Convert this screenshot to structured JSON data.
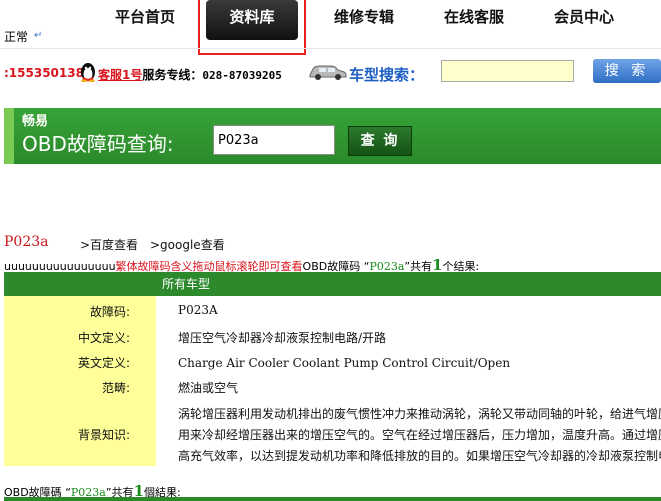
{
  "nav": {
    "items": [
      "平台首页",
      "资料库",
      "维修专辑",
      "在线客服",
      "会员中心"
    ],
    "status": "正常"
  },
  "contact": {
    "phone_partial": ":1553501388",
    "service_label": "客服1号",
    "hotline_label": "服务专线：",
    "hotline_number": "028-87039205"
  },
  "car_search": {
    "label": "车型搜索：",
    "value": "",
    "button_label": "搜 索"
  },
  "obd": {
    "brand": "畅易",
    "title": "OBD故障码查询:",
    "input_value": "P023a",
    "button_label": "查 询"
  },
  "result": {
    "code": "P023a",
    "baidu_link": ">百度查看",
    "google_link": ">google查看",
    "prefix_text": "uuuuuuuuuuuuuuuu",
    "red_note": "繁体故障码含义拖动鼠标滚轮即可查看",
    "obd_label": "OBD故障码",
    "open_quote": "“",
    "query_code": "P023a",
    "close_quote": "”共有",
    "count": "1",
    "suffix": "个结果:",
    "table_header": "所有车型",
    "rows": {
      "fault_code": {
        "label": "故障码:",
        "value": "P023A"
      },
      "cn_def": {
        "label": "中文定义:",
        "value": "增压空气冷却器冷却液泵控制电路/开路"
      },
      "en_def": {
        "label": "英文定义:",
        "value": "Charge Air Cooler Coolant Pump Control Circuit/Open"
      },
      "category": {
        "label": "范畴:",
        "value": "燃油或空气"
      },
      "background": {
        "label": "背景知识:",
        "line1": "涡轮增压器利用发动机排出的废气惯性冲力来推动涡轮，涡轮又带动同轴的叶轮，给进气增压",
        "line2": "用来冷却经增压器出来的增压空气的。空气在经过增压器后，压力增加，温度升高。通过增压",
        "line3": "高充气效率，以达到提发动机功率和降低排放的目的。如果增压空气冷却器的冷却液泵控制电"
      }
    },
    "bottom": {
      "obd_label": "OBD故障碼",
      "open_quote": "“",
      "query_code": "P023a",
      "close_quote": "”共有",
      "count": "1",
      "suffix": "個結果:"
    }
  },
  "colors": {
    "banner_green": "#2a8a2a",
    "highlight_red": "#e8231b",
    "label_yellow": "#ffff99",
    "search_yellow": "#ffffcc"
  }
}
